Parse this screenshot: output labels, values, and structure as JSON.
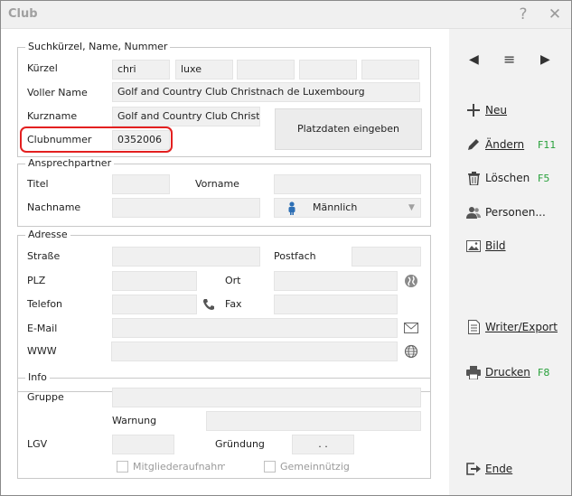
{
  "window": {
    "title": "Club",
    "help_glyph": "?",
    "close_glyph": "✕"
  },
  "search": {
    "legend": "Suchkürzel, Name, Nummer",
    "kuerzel_label": "Kürzel",
    "kuerzel_1": "chri",
    "kuerzel_2": "luxe",
    "kuerzel_3": "",
    "kuerzel_4": "",
    "kuerzel_5": "",
    "vollername_label": "Voller Name",
    "vollername_value": "Golf and Country Club Christnach de Luxembourg",
    "kurzname_label": "Kurzname",
    "kurzname_value": "Golf and Country Club Christ",
    "clubnummer_label": "Clubnummer",
    "clubnummer_value": "0352006",
    "platzdaten_button": "Platzdaten eingeben"
  },
  "contact": {
    "legend": "Ansprechpartner",
    "titel_label": "Titel",
    "titel_value": "",
    "vorname_label": "Vorname",
    "vorname_value": "",
    "nachname_label": "Nachname",
    "nachname_value": "",
    "gender_value": "Männlich"
  },
  "address": {
    "legend": "Adresse",
    "strasse_label": "Straße",
    "postfach_label": "Postfach",
    "plz_label": "PLZ",
    "ort_label": "Ort",
    "telefon_label": "Telefon",
    "fax_label": "Fax",
    "email_label": "E-Mail",
    "www_label": "WWW"
  },
  "info": {
    "legend": "Info",
    "gruppe_label": "Gruppe",
    "warnung_label": "Warnung",
    "lgv_label": "LGV",
    "gruendung_label": "Gründung",
    "gruendung_value": ". .",
    "mitglieder_label": "Mitgliederaufnahme",
    "gemeinnuetzig_label": "Gemeinnützig"
  },
  "sidebar": {
    "neu": "Neu",
    "aendern": "Ändern",
    "aendern_key": "F11",
    "loeschen": "Löschen",
    "loeschen_key": "F5",
    "personen": "Personen...",
    "bild": "Bild",
    "writer": "Writer/Export",
    "drucken": "Drucken",
    "drucken_key": "F8",
    "ende": "Ende"
  },
  "colors": {
    "highlight": "#e32020",
    "shortcut": "#27a03a",
    "field_bg": "#f0f0f0",
    "sidebar_bg": "#f2f2f2"
  }
}
